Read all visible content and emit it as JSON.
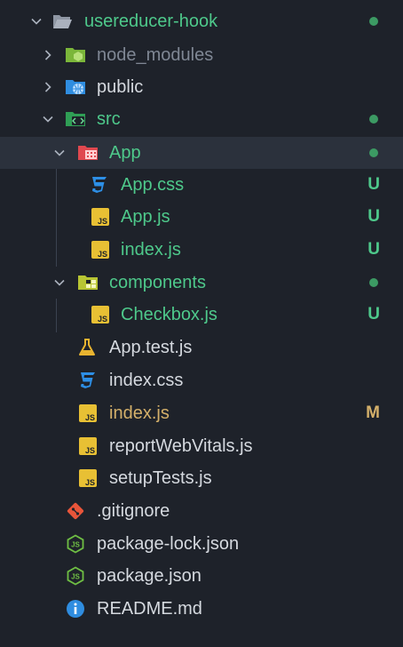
{
  "colors": {
    "background": "#1e222a",
    "selected_row": "#2b313c",
    "untracked_green": "#4ec98b",
    "modified_yellow": "#d4b06a",
    "default_text": "#d5d9df",
    "ignored_text": "#7f8794",
    "dot_green": "#3c9a63"
  },
  "explorer": {
    "root": {
      "label": "usereducer-hook",
      "icon": "folder-open-icon"
    },
    "node_modules": {
      "label": "node_modules",
      "icon": "node-folder-icon"
    },
    "public": {
      "label": "public",
      "icon": "public-folder-icon"
    },
    "src": {
      "label": "src",
      "icon": "src-folder-icon"
    },
    "app_folder": {
      "label": "App",
      "icon": "app-folder-icon"
    },
    "app_css": {
      "label": "App.css",
      "icon": "css-icon",
      "status": "U"
    },
    "app_js": {
      "label": "App.js",
      "icon": "js-icon",
      "status": "U"
    },
    "app_index_js": {
      "label": "index.js",
      "icon": "js-icon",
      "status": "U"
    },
    "components": {
      "label": "components",
      "icon": "components-folder-icon"
    },
    "checkbox_js": {
      "label": "Checkbox.js",
      "icon": "js-icon",
      "status": "U"
    },
    "app_test_js": {
      "label": "App.test.js",
      "icon": "test-flask-icon"
    },
    "index_css": {
      "label": "index.css",
      "icon": "css-icon"
    },
    "index_js": {
      "label": "index.js",
      "icon": "js-icon",
      "status": "M"
    },
    "report_web_vitals": {
      "label": "reportWebVitals.js",
      "icon": "js-icon"
    },
    "setup_tests": {
      "label": "setupTests.js",
      "icon": "js-icon"
    },
    "gitignore": {
      "label": ".gitignore",
      "icon": "git-icon"
    },
    "package_lock": {
      "label": "package-lock.json",
      "icon": "node-json-icon"
    },
    "package_json": {
      "label": "package.json",
      "icon": "node-json-icon"
    },
    "readme": {
      "label": "README.md",
      "icon": "info-icon"
    }
  }
}
